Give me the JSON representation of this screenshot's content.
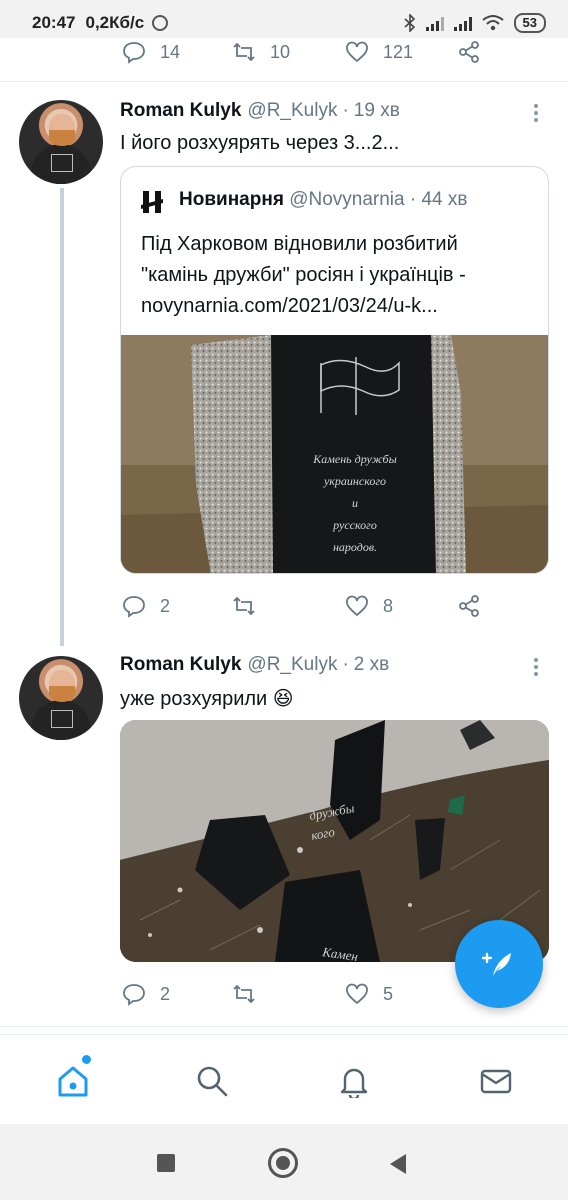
{
  "status_bar": {
    "time": "20:47",
    "net_speed": "0,2Кб/с",
    "battery": "53"
  },
  "prev_tweet": {
    "replies": "14",
    "retweets": "10",
    "likes": "121"
  },
  "tweets": [
    {
      "name": "Roman Kulyk",
      "handle": "@R_Kulyk",
      "time": "19 хв",
      "text": "І його розхуярять через 3...2...",
      "quote": {
        "name": "Новинарня",
        "handle": "@Novynarnia",
        "time": "44 хв",
        "text_line1": "Під Харковом відновили розбитий",
        "text_line2": "\"камінь дружби\" росіян і українців -",
        "text_line3": "novynarnia.com/2021/03/24/u-k...",
        "image_lines": [
          "Камень дружбы",
          "украинского",
          "и",
          "русского",
          "народов."
        ]
      },
      "replies": "2",
      "likes": "8"
    },
    {
      "name": "Roman Kulyk",
      "handle": "@R_Kulyk",
      "time": "2 хв",
      "text": "уже розхуярили 😆",
      "image_fragments": [
        "дружбы",
        "кого",
        "Камен"
      ],
      "replies": "2",
      "likes": "5"
    }
  ],
  "separator": "·",
  "colors": {
    "accent": "#1d9bf0",
    "secondary_text": "#657786",
    "border": "#cfd9de"
  },
  "nav": {
    "items": [
      "home-icon",
      "search-icon",
      "notifications-icon",
      "messages-icon"
    ]
  }
}
